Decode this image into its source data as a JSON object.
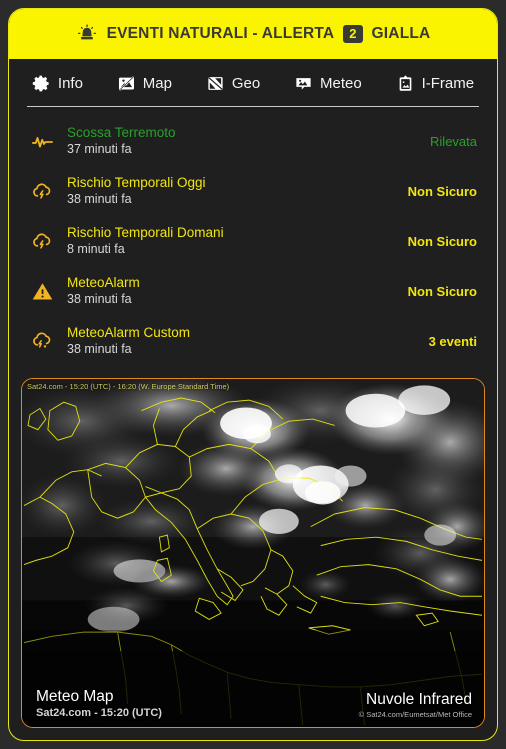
{
  "header": {
    "icon": "siren-beacon-icon",
    "title": "EVENTI NATURALI - ALLERTA",
    "badge": "2",
    "level": "GIALLA",
    "bg_color": "#fbf400",
    "text_color": "#3a3a34"
  },
  "tabs": [
    {
      "label": "Info",
      "icon": "gear-icon"
    },
    {
      "label": "Map",
      "icon": "map-slash-icon"
    },
    {
      "label": "Geo",
      "icon": "globe-slice-icon"
    },
    {
      "label": "Meteo",
      "icon": "image-bubble-icon"
    },
    {
      "label": "I-Frame",
      "icon": "clipboard-image-icon"
    }
  ],
  "events": [
    {
      "icon": "seismograph-wave-icon",
      "title": "Scossa Terremoto",
      "time": "37 minuti fa",
      "status": "Rilevata",
      "color": "#2aa02a"
    },
    {
      "icon": "thunderstorm-cloud-icon",
      "title": "Rischio Temporali Oggi",
      "time": "38 minuti fa",
      "status": "Non Sicuro",
      "color": "#f2e70c"
    },
    {
      "icon": "thunderstorm-cloud-icon",
      "title": "Rischio Temporali Domani",
      "time": "8 minuti fa",
      "status": "Non Sicuro",
      "color": "#f2e70c"
    },
    {
      "icon": "warning-triangle-icon",
      "title": "MeteoAlarm",
      "time": "38 minuti fa",
      "status": "Non Sicuro",
      "color": "#f2e70c"
    },
    {
      "icon": "storm-rain-cloud-icon",
      "title": "MeteoAlarm Custom",
      "time": "38 minuti fa",
      "status": "3 eventi",
      "color": "#f2e70c"
    }
  ],
  "map": {
    "watermark": "Sat24.com - 15:20 (UTC) - 16:20 (W. Europe Standard Time)",
    "caption_title": "Meteo Map",
    "caption_source": "Sat24.com - 15:20 (UTC)",
    "layer_title": "Nuvole Infrared",
    "copyright": "© Sat24.com/Eumetsat/Met Office",
    "border_color": "#e08a1e",
    "coastline_color": "#e8e80f"
  }
}
